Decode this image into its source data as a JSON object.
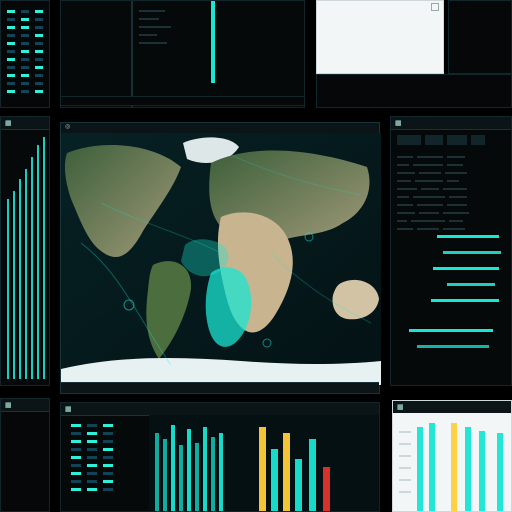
{
  "theme": {
    "background": "#000000",
    "panel": "#06090a",
    "accent_cyan": "#19e6d3",
    "accent_yellow": "#ffcf3a",
    "accent_red": "#e3332d"
  },
  "panels": {
    "left_top": {
      "title": "",
      "icon": "menu-icon"
    },
    "top_center": {
      "title": "",
      "icon": "window-icon"
    },
    "right_top_light": {
      "title": "",
      "icon": "document-icon"
    },
    "left_mid": {
      "title": "",
      "icon": "window-icon"
    },
    "map": {
      "title": "",
      "subtitle": "",
      "footer": "",
      "icon": "globe-icon"
    },
    "right_mid": {
      "title": "",
      "icon": "window-icon"
    },
    "bottom_left": {
      "title": "",
      "icon": "window-icon"
    },
    "bottom_center": {
      "title": "",
      "icon": "window-icon"
    },
    "bottom_right_light": {
      "title": "",
      "icon": "window-icon"
    }
  },
  "misc": {
    "status_left": "",
    "status_right": ""
  }
}
